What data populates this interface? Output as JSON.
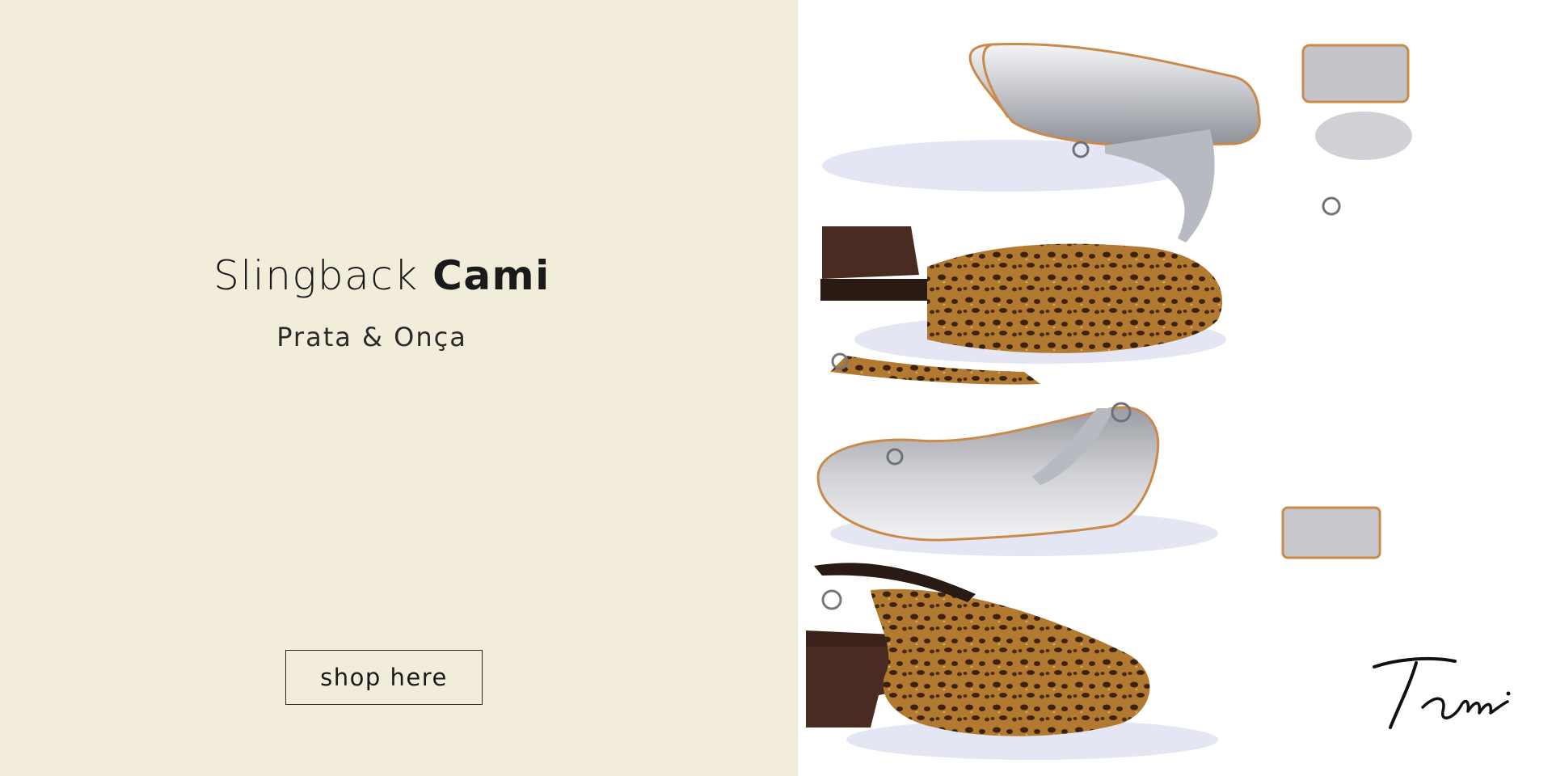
{
  "hero": {
    "title_light": "Slingback",
    "title_bold": "Cami",
    "subtitle": "Prata & Onça",
    "cta_label": "shop here"
  },
  "brand": {
    "signature_text": "Tami"
  },
  "colors": {
    "left_background": "#f2ecda",
    "right_background": "#ffffff",
    "text": "#1a1a1a",
    "silver": "#c9cbd0",
    "leopard_base": "#b0782e",
    "leopard_spot": "#3b2210",
    "heel_brown": "#4a2b22",
    "sole_tan": "#c98a4a"
  }
}
